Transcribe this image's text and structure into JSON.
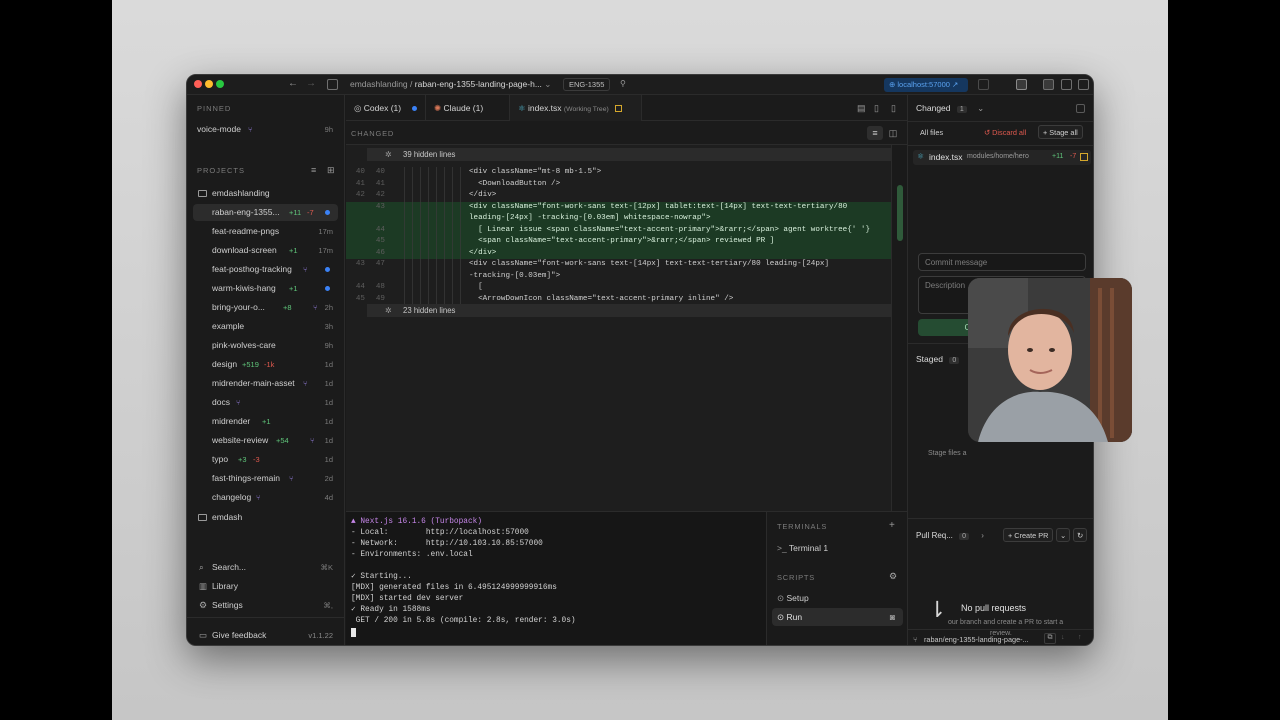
{
  "window": {
    "breadcrumb_project": "emdashlanding",
    "breadcrumb_sep": "/",
    "breadcrumb_branch": "raban-eng-1355-landing-page-h...",
    "issue_badge": "ENG-1355",
    "localhost_label": "localhost:57000"
  },
  "sidebar": {
    "pinned_label": "PINNED",
    "pinned": [
      {
        "name": "voice-mode",
        "time": "9h"
      }
    ],
    "projects_label": "PROJECTS",
    "project_root": "emdashlanding",
    "items": [
      {
        "name": "raban-eng-1355...",
        "added": "+11",
        "removed": "-7",
        "time": ""
      },
      {
        "name": "feat-readme-pngs",
        "added": "",
        "removed": "",
        "time": "17m"
      },
      {
        "name": "download-screen",
        "added": "+1",
        "removed": "",
        "time": "17m"
      },
      {
        "name": "feat-posthog-tracking",
        "added": "",
        "removed": "",
        "time": ""
      },
      {
        "name": "warm-kiwis-hang",
        "added": "+1",
        "removed": "",
        "time": ""
      },
      {
        "name": "bring-your-o...",
        "added": "+8",
        "removed": "",
        "time": "2h"
      },
      {
        "name": "example",
        "added": "",
        "removed": "",
        "time": "3h"
      },
      {
        "name": "pink-wolves-care",
        "added": "",
        "removed": "",
        "time": "9h"
      },
      {
        "name": "design",
        "added": "+519",
        "removed": "-1k",
        "time": "1d"
      },
      {
        "name": "midrender-main-asset",
        "added": "",
        "removed": "",
        "time": "1d"
      },
      {
        "name": "docs",
        "added": "",
        "removed": "",
        "time": "1d"
      },
      {
        "name": "midrender",
        "added": "+1",
        "removed": "",
        "time": "1d"
      },
      {
        "name": "website-review",
        "added": "+54",
        "removed": "",
        "time": "1d"
      },
      {
        "name": "typo",
        "added": "+3",
        "removed": "-3",
        "time": "1d"
      },
      {
        "name": "fast-things-remain",
        "added": "",
        "removed": "",
        "time": "2d"
      },
      {
        "name": "changelog",
        "added": "",
        "removed": "",
        "time": "4d"
      }
    ],
    "project_root_2": "emdash",
    "search_label": "Search...",
    "search_shortcut": "⌘K",
    "library_label": "Library",
    "settings_label": "Settings",
    "settings_shortcut": "⌘,",
    "feedback_label": "Give feedback",
    "version": "v1.1.22"
  },
  "tabs": [
    {
      "label": "Codex (1)"
    },
    {
      "label": "Claude (1)"
    },
    {
      "label": "index.tsx",
      "sub": "(Working Tree)"
    }
  ],
  "diff": {
    "section_label": "CHANGED",
    "hidden_top": "39 hidden lines",
    "hidden_bottom": "23 hidden lines",
    "rows": [
      {
        "a": "40",
        "b": "40",
        "code": "<div className=\"mt-8 mb-1.5\">",
        "type": "ctx"
      },
      {
        "a": "41",
        "b": "41",
        "code": "  <DownloadButton />",
        "type": "ctx"
      },
      {
        "a": "42",
        "b": "42",
        "code": "</div>",
        "type": "ctx"
      },
      {
        "a": "",
        "b": "43",
        "code": "<div className=\"font-work-sans text-[12px] tablet:text-[14px] text-text-tertiary/80",
        "type": "add"
      },
      {
        "a": "",
        "b": "",
        "code": "leading-[24px] -tracking-[0.03em] whitespace-nowrap\">",
        "type": "add"
      },
      {
        "a": "",
        "b": "44",
        "code": "  [ Linear issue <span className=\"text-accent-primary\">&rarr;</span> agent worktree{' '}",
        "type": "add"
      },
      {
        "a": "",
        "b": "45",
        "code": "  <span className=\"text-accent-primary\">&rarr;</span> reviewed PR ]",
        "type": "add"
      },
      {
        "a": "",
        "b": "46",
        "code": "</div>",
        "type": "add"
      },
      {
        "a": "43",
        "b": "47",
        "code": "<div className=\"font-work-sans text-[14px] text-text-tertiary/80 leading-[24px]",
        "type": "ctx"
      },
      {
        "a": "",
        "b": "",
        "code": "-tracking-[0.03em]\">",
        "type": "ctx"
      },
      {
        "a": "44",
        "b": "48",
        "code": "  [",
        "type": "ctx"
      },
      {
        "a": "45",
        "b": "49",
        "code": "  <ArrowDownIcon className=\"text-accent-primary inline\" />",
        "type": "ctx"
      }
    ]
  },
  "terminal": {
    "lines": [
      "▲ Next.js 16.1.6 (Turbopack)",
      "- Local:        http://localhost:57000",
      "- Network:      http://10.103.10.85:57000",
      "- Environments: .env.local",
      "",
      "✓ Starting...",
      "[MDX] generated files in 6.495124999999916ms",
      "[MDX] started dev server",
      "✓ Ready in 1588ms",
      " GET / 200 in 5.8s (compile: 2.8s, render: 3.0s)"
    ],
    "terminals_label": "TERMINALS",
    "terminal_item": "Terminal 1",
    "scripts_label": "SCRIPTS",
    "script_setup": "Setup",
    "script_run": "Run"
  },
  "right": {
    "changed_label": "Changed",
    "changed_count": "1",
    "all_files": "All files",
    "discard_all": "Discard all",
    "stage_all": "Stage all",
    "file_name": "index.tsx",
    "file_path": "modules/home/hero",
    "file_added": "+11",
    "file_removed": "-7",
    "commit_placeholder": "Commit message",
    "description_placeholder": "Description",
    "commit_push": "Commit & Push",
    "staged_label": "Staged",
    "staged_count": "0",
    "staged_hint": "Stage files a",
    "pr_label": "Pull Req...",
    "pr_count": "0",
    "create_pr": "Create PR",
    "no_pr_title": "No pull requests",
    "no_pr_hint_1": "our branch and create a PR to start a",
    "no_pr_hint_2": "review.",
    "branch_footer": "raban/eng-1355-landing-page-..."
  },
  "colors": {
    "accent_green": "#5fc47a",
    "accent_red": "#e05a4f",
    "localhost_bg": "#15375f",
    "diff_add_bg": "#1c3a24"
  }
}
